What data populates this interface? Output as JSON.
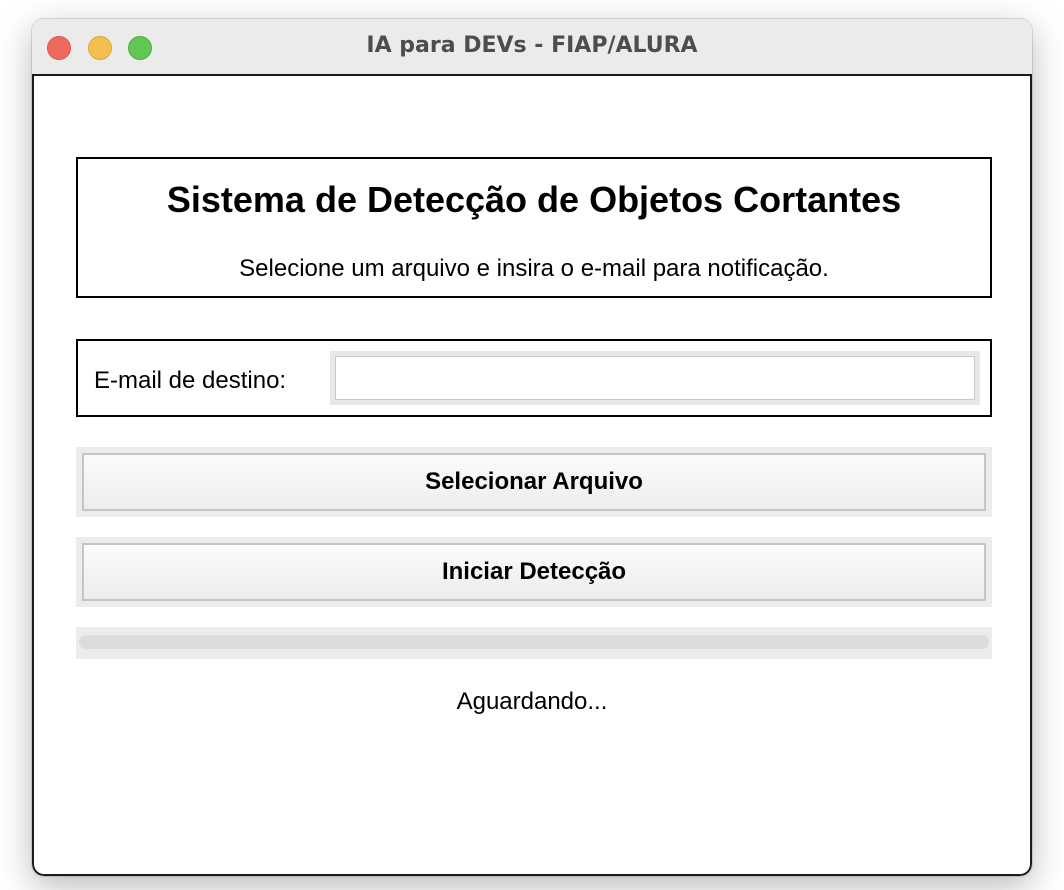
{
  "window": {
    "title": "IA para DEVs - FIAP/ALURA"
  },
  "header": {
    "title": "Sistema de Detecção de Objetos Cortantes",
    "subtitle": "Selecione um arquivo e insira o e-mail para notificação."
  },
  "email": {
    "label": "E-mail de destino:",
    "value": "",
    "placeholder": ""
  },
  "buttons": {
    "select_file": "Selecionar Arquivo",
    "start_detection": "Iniciar Detecção"
  },
  "progress": {
    "value": 0
  },
  "status": {
    "text": "Aguardando..."
  },
  "colors": {
    "close": "#ee6a5f",
    "minimize": "#f5bf4f",
    "zoom": "#62c655"
  }
}
